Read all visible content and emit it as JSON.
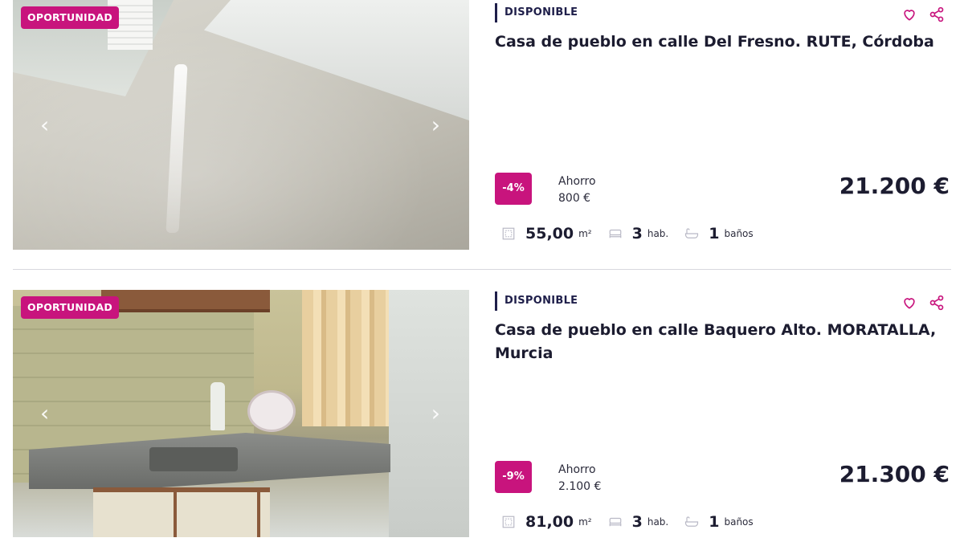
{
  "colors": {
    "accent": "#c8147d",
    "status_bar": "#1f1f4a",
    "text": "#1c1c30",
    "icon": "#b9b9c6"
  },
  "listings": [
    {
      "badge": "OPORTUNIDAD",
      "status": "DISPONIBLE",
      "title": "Casa de pueblo en calle Del Fresno. RUTE, Córdoba",
      "discount": "-4%",
      "savings_label": "Ahorro",
      "savings_value": "800 €",
      "price": "21.200 €",
      "area_value": "55,00",
      "area_unit": "m²",
      "rooms_value": "3",
      "rooms_unit": "hab.",
      "baths_value": "1",
      "baths_unit": "baños",
      "photo": "floor-interior-photo",
      "arrows": {
        "prev": "‹",
        "next": "›"
      }
    },
    {
      "badge": "OPORTUNIDAD",
      "status": "DISPONIBLE",
      "title": "Casa de pueblo en calle Baquero Alto. MORATALLA, Murcia",
      "discount": "-9%",
      "savings_label": "Ahorro",
      "savings_value": "2.100 €",
      "price": "21.300 €",
      "area_value": "81,00",
      "area_unit": "m²",
      "rooms_value": "3",
      "rooms_unit": "hab.",
      "baths_value": "1",
      "baths_unit": "baños",
      "photo": "kitchen-interior-photo",
      "arrows": {
        "prev": "‹",
        "next": "›"
      }
    }
  ],
  "icons": {
    "favorite": "heart-icon",
    "share": "share-icon",
    "area": "area-icon",
    "rooms": "bed-icon",
    "baths": "bathtub-icon"
  }
}
